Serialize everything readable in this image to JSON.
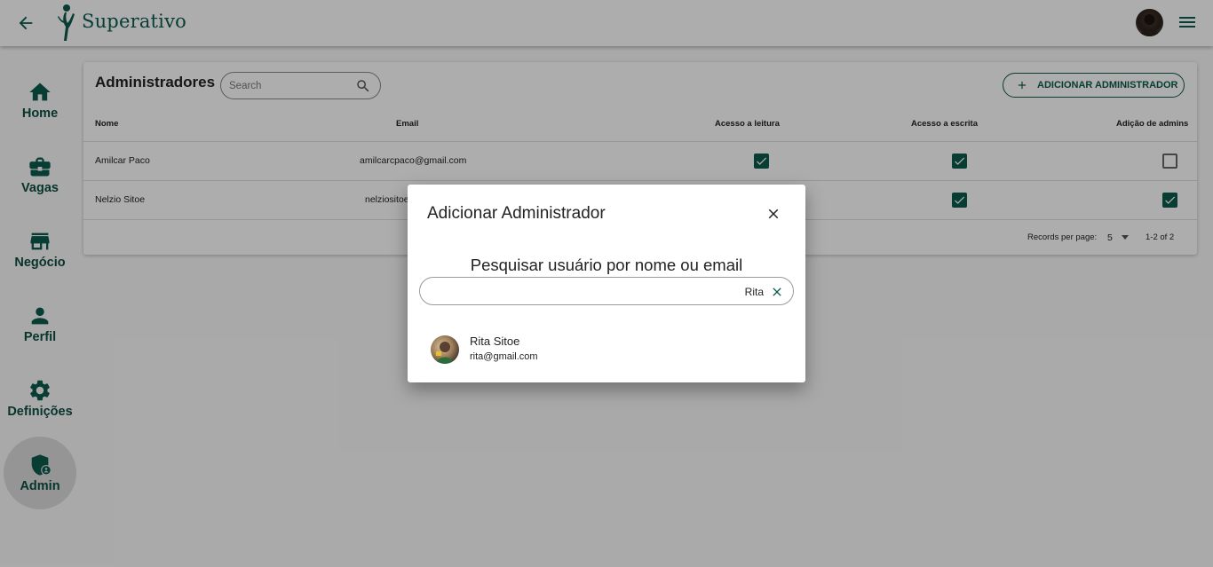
{
  "app": {
    "brand": "Superativo"
  },
  "colors": {
    "accent": "#0b5b4c",
    "sidebar_label": "#0d4d40"
  },
  "topbar": {
    "back_icon": "arrow-left-icon",
    "menu_icon": "hamburger-menu-icon"
  },
  "sidebar": {
    "items": [
      {
        "label": "Home",
        "icon": "home-icon",
        "active": false
      },
      {
        "label": "Vagas",
        "icon": "briefcase-icon",
        "active": false
      },
      {
        "label": "Negócio",
        "icon": "store-icon",
        "active": false
      },
      {
        "label": "Perfil",
        "icon": "person-icon",
        "active": false
      },
      {
        "label": "Definições",
        "icon": "gear-icon",
        "active": false
      },
      {
        "label": "Admin",
        "icon": "admin-shield-icon",
        "active": true
      }
    ]
  },
  "admins": {
    "title": "Administradores",
    "search_placeholder": "Search",
    "add_button": "ADICIONAR ADMINISTRADOR",
    "columns": [
      "Nome",
      "Email",
      "Acesso a leitura",
      "Acesso a escrita",
      "Adição de admins"
    ],
    "rows": [
      {
        "name": "Amilcar Paco",
        "email": "amilcarcpaco@gmail.com",
        "read": true,
        "write": true,
        "add_admins": false
      },
      {
        "name": "Nelzio Sitoe",
        "email": "nelziositoe",
        "read": true,
        "write": true,
        "add_admins": true
      }
    ],
    "footer": {
      "records_label": "Records per page:",
      "per_page": "5",
      "range": "1-2 of 2"
    }
  },
  "dialog": {
    "title": "Adicionar Administrador",
    "subtitle": "Pesquisar usuário por nome ou email",
    "search_value": "Rita",
    "results": [
      {
        "name": "Rita Sitoe",
        "email": "rita@gmail.com"
      }
    ]
  }
}
